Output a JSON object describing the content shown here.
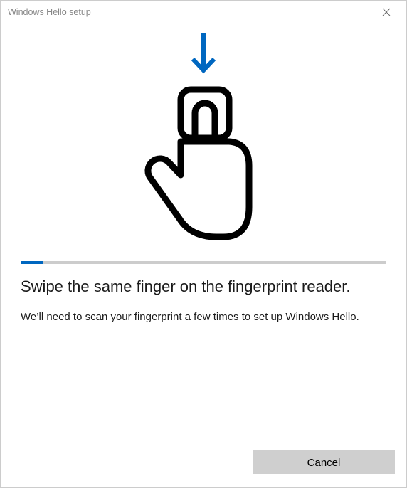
{
  "window": {
    "title": "Windows Hello setup"
  },
  "progress": {
    "percent": 6
  },
  "main": {
    "heading": "Swipe the same finger on the fingerprint reader.",
    "subtext": "We’ll need to scan your fingerprint a few times to set up Windows Hello."
  },
  "footer": {
    "cancel_label": "Cancel"
  },
  "colors": {
    "accent": "#0067c0"
  }
}
